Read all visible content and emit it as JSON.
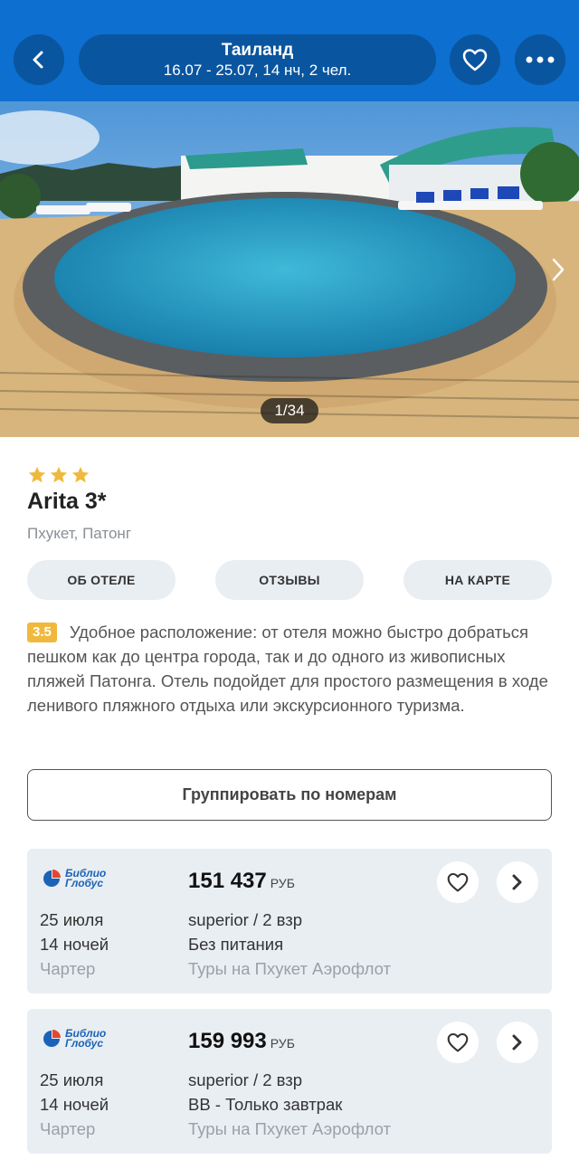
{
  "header": {
    "title": "Таиланд",
    "subtitle": "16.07 - 25.07, 14 нч, 2 чел."
  },
  "gallery": {
    "counter": "1/34"
  },
  "hotel": {
    "stars": 3,
    "name": "Arita 3*",
    "location": "Пхукет, Патонг",
    "rating": "3.5",
    "description": "Удобное расположение: от отеля можно быстро добраться пешком как до центра города, так и до одного из живописных пляжей Патонга. Отель подойдет для простого размещения в ходе ленивого пляжного отдыха или экскурсионного туризма."
  },
  "tabs": [
    "ОБ ОТЕЛЕ",
    "ОТЗЫВЫ",
    "НА КАРТЕ"
  ],
  "group_button": "Группировать по номерам",
  "colors": {
    "header": "#0d6fcf",
    "accent_star": "#f0b93d",
    "card_bg": "#e9eef3"
  },
  "offers": [
    {
      "operator_line1": "Библио",
      "operator_line2": "Глобус",
      "price": "151 437",
      "currency": "РУБ",
      "date": "25 июля",
      "nights": "14 ночей",
      "flight": "Чартер",
      "room": "superior / 2 взр",
      "meal": "Без питания",
      "tour": "Туры на Пхукет Аэрофлот"
    },
    {
      "operator_line1": "Библио",
      "operator_line2": "Глобус",
      "price": "159 993",
      "currency": "РУБ",
      "date": "25 июля",
      "nights": "14 ночей",
      "flight": "Чартер",
      "room": "superior / 2 взр",
      "meal": "BB - Только завтрак",
      "tour": "Туры на Пхукет Аэрофлот"
    }
  ]
}
